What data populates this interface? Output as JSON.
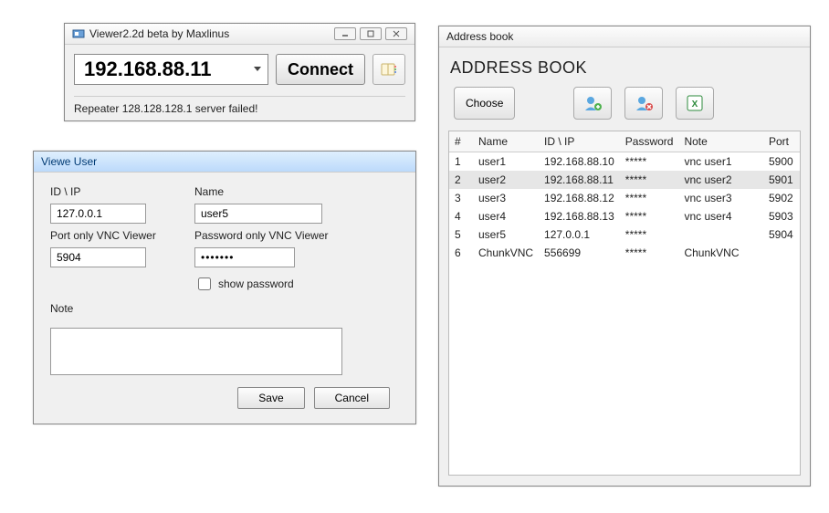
{
  "viewer": {
    "title": "Viewer2.2d beta by Maxlinus",
    "ip_value": "192.168.88.11",
    "connect_label": "Connect",
    "status_text": "Repeater 128.128.128.1 server failed!"
  },
  "user_form": {
    "title": "Viewe User",
    "labels": {
      "id_ip": "ID \\ IP",
      "name": "Name",
      "port": "Port only VNC Viewer",
      "password": "Password only VNC Viewer",
      "show_password": "show password",
      "note": "Note"
    },
    "values": {
      "id_ip": "127.0.0.1",
      "name": "user5",
      "port": "5904",
      "password": "•••••••",
      "note": ""
    },
    "save_label": "Save",
    "cancel_label": "Cancel"
  },
  "address_book": {
    "title": "Address book",
    "heading": "ADDRESS BOOK",
    "choose_label": "Choose",
    "columns": {
      "num": "#",
      "name": "Name",
      "id_ip": "ID \\ IP",
      "password": "Password",
      "note": "Note",
      "port": "Port"
    },
    "rows": [
      {
        "num": "1",
        "name": "user1",
        "id_ip": "192.168.88.10",
        "password": "*****",
        "note": "vnc user1",
        "port": "5900",
        "selected": false
      },
      {
        "num": "2",
        "name": "user2",
        "id_ip": "192.168.88.11",
        "password": "*****",
        "note": "vnc user2",
        "port": "5901",
        "selected": true
      },
      {
        "num": "3",
        "name": "user3",
        "id_ip": "192.168.88.12",
        "password": "*****",
        "note": "vnc user3",
        "port": "5902",
        "selected": false
      },
      {
        "num": "4",
        "name": "user4",
        "id_ip": "192.168.88.13",
        "password": "*****",
        "note": "vnc user4",
        "port": "5903",
        "selected": false
      },
      {
        "num": "5",
        "name": "user5",
        "id_ip": "127.0.0.1",
        "password": "*****",
        "note": "",
        "port": "5904",
        "selected": false
      },
      {
        "num": "6",
        "name": "ChunkVNC",
        "id_ip": "556699",
        "password": "*****",
        "note": "ChunkVNC",
        "port": "",
        "selected": false
      }
    ]
  }
}
